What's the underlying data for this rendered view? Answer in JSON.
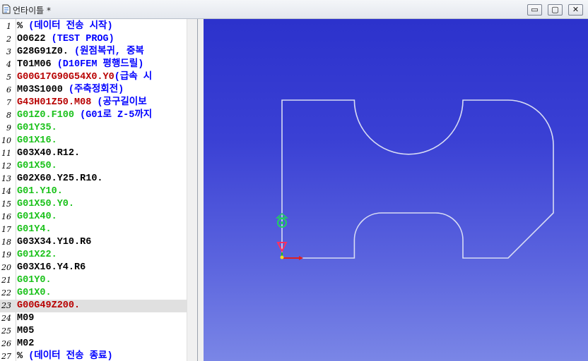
{
  "window": {
    "title": "언타이틀 *",
    "minimize_glyph": "▭",
    "maximize_glyph": "▢",
    "close_glyph": "✕"
  },
  "colors": {
    "code_black": "#000000",
    "code_green": "#19c119",
    "code_red": "#b80000",
    "comment_blue": "#0000ff",
    "viewport_bg": "#3a40d4",
    "toolpath": "#d8dcf4"
  },
  "editor": {
    "current_line": 23,
    "lines": [
      {
        "n": "1",
        "code": "%",
        "comment": " (데이터 전송 시작)",
        "color": "#000000"
      },
      {
        "n": "2",
        "code": "O0622",
        "comment": " (TEST PROG)",
        "color": "#000000"
      },
      {
        "n": "3",
        "code": "G28G91Z0.",
        "comment": " (원점복귀, 중복",
        "color": "#000000"
      },
      {
        "n": "4",
        "code": "T01M06",
        "comment": " (D10FEM 평행드릴)",
        "color": "#000000"
      },
      {
        "n": "5",
        "code": "G00G17G90G54X0.Y0",
        "comment": "(급속 시",
        "color": "#b80000"
      },
      {
        "n": "6",
        "code": "M03S1000",
        "comment": " (주축정회전)",
        "color": "#000000"
      },
      {
        "n": "7",
        "code": "G43H01Z50.M08",
        "comment": " (공구길이보",
        "color": "#b80000"
      },
      {
        "n": "8",
        "code": "G01Z0.F100",
        "comment": " (G01로 Z-5까지",
        "color": "#19c119"
      },
      {
        "n": "9",
        "code": "G01Y35.",
        "comment": "",
        "color": "#19c119"
      },
      {
        "n": "10",
        "code": "G01X16.",
        "comment": "",
        "color": "#19c119"
      },
      {
        "n": "11",
        "code": "G03X40.R12.",
        "comment": "",
        "color": "#000000"
      },
      {
        "n": "12",
        "code": "G01X50.",
        "comment": "",
        "color": "#19c119"
      },
      {
        "n": "13",
        "code": "G02X60.Y25.R10.",
        "comment": "",
        "color": "#000000"
      },
      {
        "n": "14",
        "code": "G01.Y10.",
        "comment": "",
        "color": "#19c119"
      },
      {
        "n": "15",
        "code": "G01X50.Y0.",
        "comment": "",
        "color": "#19c119"
      },
      {
        "n": "16",
        "code": "G01X40.",
        "comment": "",
        "color": "#19c119"
      },
      {
        "n": "17",
        "code": "G01Y4.",
        "comment": "",
        "color": "#19c119"
      },
      {
        "n": "18",
        "code": "G03X34.Y10.R6",
        "comment": "",
        "color": "#000000"
      },
      {
        "n": "19",
        "code": "G01X22.",
        "comment": "",
        "color": "#19c119"
      },
      {
        "n": "20",
        "code": "G03X16.Y4.R6",
        "comment": "",
        "color": "#000000"
      },
      {
        "n": "21",
        "code": "G01Y0.",
        "comment": "",
        "color": "#19c119"
      },
      {
        "n": "22",
        "code": "G01X0.",
        "comment": "",
        "color": "#19c119"
      },
      {
        "n": "23",
        "code": "G00G49Z200.",
        "comment": "",
        "color": "#b80000"
      },
      {
        "n": "24",
        "code": "M09",
        "comment": "",
        "color": "#000000"
      },
      {
        "n": "25",
        "code": "M05",
        "comment": "",
        "color": "#000000"
      },
      {
        "n": "26",
        "code": "M02",
        "comment": "",
        "color": "#000000"
      },
      {
        "n": "27",
        "code": "%",
        "comment": " (데이터 전송 종료)",
        "color": "#000000"
      }
    ]
  },
  "toolpath": {
    "commands": [
      {
        "op": "G01",
        "x": 0,
        "y": 35
      },
      {
        "op": "G01",
        "x": 16,
        "y": 35
      },
      {
        "op": "G03",
        "x": 40,
        "y": 35,
        "r": 12
      },
      {
        "op": "G01",
        "x": 50,
        "y": 35
      },
      {
        "op": "G02",
        "x": 60,
        "y": 25,
        "r": 10
      },
      {
        "op": "G01",
        "x": 60,
        "y": 10
      },
      {
        "op": "G01",
        "x": 50,
        "y": 0
      },
      {
        "op": "G01",
        "x": 40,
        "y": 0
      },
      {
        "op": "G01",
        "x": 40,
        "y": 4
      },
      {
        "op": "G03",
        "x": 34,
        "y": 10,
        "r": 6
      },
      {
        "op": "G01",
        "x": 22,
        "y": 10
      },
      {
        "op": "G03",
        "x": 16,
        "y": 4,
        "r": 6
      },
      {
        "op": "G01",
        "x": 16,
        "y": 0
      },
      {
        "op": "G01",
        "x": 0,
        "y": 0
      }
    ]
  }
}
